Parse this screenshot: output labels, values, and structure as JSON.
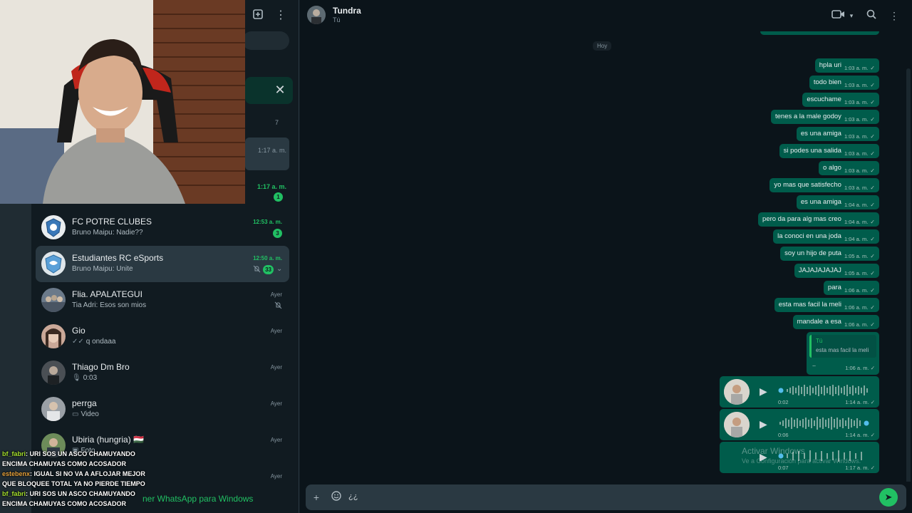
{
  "sidebar": {
    "archived_count": "7",
    "partial_time_1": "1:17 a. m.",
    "partial_time_2": "1:17 a. m.",
    "partial_badge": "1",
    "chats": [
      {
        "name": "FC POTRE CLUBES",
        "preview": "Bruno Maipu: Nadie??",
        "time": "12:53 a. m.",
        "badge": "3",
        "unread": true,
        "muted": false,
        "icon": ""
      },
      {
        "name": "Estudiantes RC eSports",
        "preview": "Bruno Maipu: Unite",
        "time": "12:50 a. m.",
        "badge": "33",
        "unread": true,
        "muted": true,
        "icon": ""
      },
      {
        "name": "Flia. APALATEGUI",
        "preview": "Tia Adri: Esos son  mios",
        "time": "Ayer",
        "badge": "",
        "unread": false,
        "muted": true,
        "icon": ""
      },
      {
        "name": "Gio",
        "preview": "q ondaaa",
        "time": "Ayer",
        "badge": "",
        "unread": false,
        "muted": false,
        "icon": "double-check-icon"
      },
      {
        "name": "Thiago Dm Bro",
        "preview": "0:03",
        "time": "Ayer",
        "badge": "",
        "unread": false,
        "muted": false,
        "icon": "microphone-icon"
      },
      {
        "name": "perrga",
        "preview": "Video",
        "time": "Ayer",
        "badge": "",
        "unread": false,
        "muted": false,
        "icon": "video-icon"
      },
      {
        "name": "Ubiria (hungria) 🇭🇺",
        "preview": "Foto",
        "time": "Ayer",
        "badge": "",
        "unread": false,
        "muted": false,
        "icon": "photo-icon"
      },
      {
        "name": "",
        "preview": "",
        "time": "Ayer",
        "badge": "",
        "unread": false,
        "muted": false,
        "icon": ""
      }
    ],
    "promo": "ner WhatsApp para Windows"
  },
  "stream_chat": [
    {
      "user": "bf_fabri",
      "text": ": URI SOS UN ASCO CHAMUYANDO ENCIMA CHAMUYAS COMO ACOSADOR",
      "color": "green"
    },
    {
      "user": "estebenx",
      "text": ": IGUAL SI NO VA A AFLOJAR MEJOR QUE BLOQUEE TOTAL YA NO PIERDE TIEMPO",
      "color": "orange"
    },
    {
      "user": "bf_fabri",
      "text": ": URI SOS UN ASCO CHAMUYANDO ENCIMA CHAMUYAS COMO ACOSADOR",
      "color": "green"
    }
  ],
  "conversation": {
    "title": "Tundra",
    "subtitle": "Tú",
    "date_label": "Hoy",
    "messages": [
      {
        "text": "hpla uri",
        "time": "1:03 a. m."
      },
      {
        "text": "todo bien",
        "time": "1:03 a. m."
      },
      {
        "text": "escuchame",
        "time": "1:03 a. m."
      },
      {
        "text": "tenes a la male godoy",
        "time": "1:03 a. m."
      },
      {
        "text": "es una amiga",
        "time": "1:03 a. m."
      },
      {
        "text": "si podes una salida",
        "time": "1:03 a. m."
      },
      {
        "text": "o algo",
        "time": "1:03 a. m."
      },
      {
        "text": "yo mas que satisfecho",
        "time": "1:03 a. m."
      },
      {
        "text": "es una amiga",
        "time": "1:04 a. m."
      },
      {
        "text": "pero da para alg mas creo",
        "time": "1:04 a. m."
      },
      {
        "text": "la conoci en una joda",
        "time": "1:04 a. m."
      },
      {
        "text": "soy un hijo de puta",
        "time": "1:05 a. m."
      },
      {
        "text": "JAJAJAJAJAJ",
        "time": "1:05 a. m."
      },
      {
        "text": "para",
        "time": "1:06 a. m."
      },
      {
        "text": "esta mas facil la meli",
        "time": "1:06 a. m."
      },
      {
        "text": "mandale a esa",
        "time": "1:06 a. m."
      }
    ],
    "reply": {
      "author": "Tú",
      "quoted": "esta mas facil la meli",
      "body": "..",
      "time": "1:06 a. m."
    },
    "voice_notes": [
      {
        "duration": "0:02",
        "time": "1:14 a. m."
      },
      {
        "duration": "0:06",
        "time": "1:14 a. m."
      },
      {
        "duration": "0:07",
        "time": "1:17 a. m."
      }
    ],
    "watermark": "Activar Windows",
    "watermark_sub": "Ve a Configuración para activar Windows.",
    "composer_text": "¿¿"
  },
  "colors": {
    "accent": "#21c063",
    "bubble_out": "#005c4b",
    "bg": "#0b141a",
    "panel": "#111b21"
  }
}
